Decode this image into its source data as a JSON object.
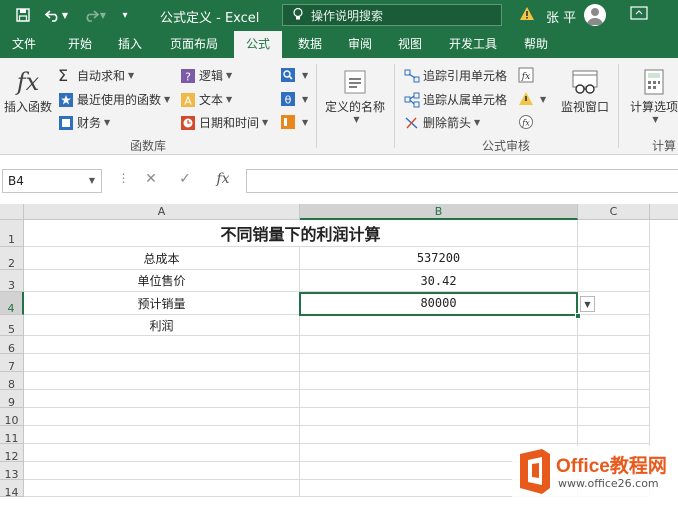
{
  "window": {
    "title": "公式定义  -  Excel",
    "search_placeholder": "操作说明搜索",
    "user": "张 平"
  },
  "tabs": [
    {
      "label": "文件"
    },
    {
      "label": "开始"
    },
    {
      "label": "插入"
    },
    {
      "label": "页面布局"
    },
    {
      "label": "公式",
      "active": true
    },
    {
      "label": "数据"
    },
    {
      "label": "审阅"
    },
    {
      "label": "视图"
    },
    {
      "label": "开发工具"
    },
    {
      "label": "帮助"
    }
  ],
  "ribbon": {
    "function_library": {
      "label": "函数库",
      "insert_function": "插入函数",
      "autosum": "自动求和",
      "recent": "最近使用的函数",
      "financial": "财务",
      "logical": "逻辑",
      "text": "文本",
      "datetime": "日期和时间",
      "fx_symbol": "fx"
    },
    "defined_names": {
      "label": "定义的名称"
    },
    "formula_auditing": {
      "label": "公式审核",
      "trace_precedents": "追踪引用单元格",
      "trace_dependents": "追踪从属单元格",
      "remove_arrows": "删除箭头",
      "watch_window": "监视窗口"
    },
    "calculation": {
      "label": "计算",
      "options": "计算选项"
    }
  },
  "formula_bar": {
    "name_box": "B4",
    "cancel": "✕",
    "enter": "✓",
    "fx": "fx",
    "content": ""
  },
  "sheet": {
    "columns": [
      "A",
      "B",
      "C"
    ],
    "selected_column": "B",
    "selected_row": 4,
    "rows": [
      "1",
      "2",
      "3",
      "4",
      "5",
      "6",
      "7",
      "8",
      "9",
      "10",
      "11",
      "12",
      "13",
      "14"
    ],
    "title": "不同销量下的利润计算",
    "labels": [
      "总成本",
      "单位售价",
      "预计销量",
      "利润"
    ],
    "values": [
      "537200",
      "30.42",
      "80000",
      ""
    ]
  },
  "watermark": {
    "brand": "Office教程网",
    "url": "www.office26.com"
  },
  "colors": {
    "excel_green": "#217346",
    "ribbon_bg": "#f3f3f3"
  }
}
